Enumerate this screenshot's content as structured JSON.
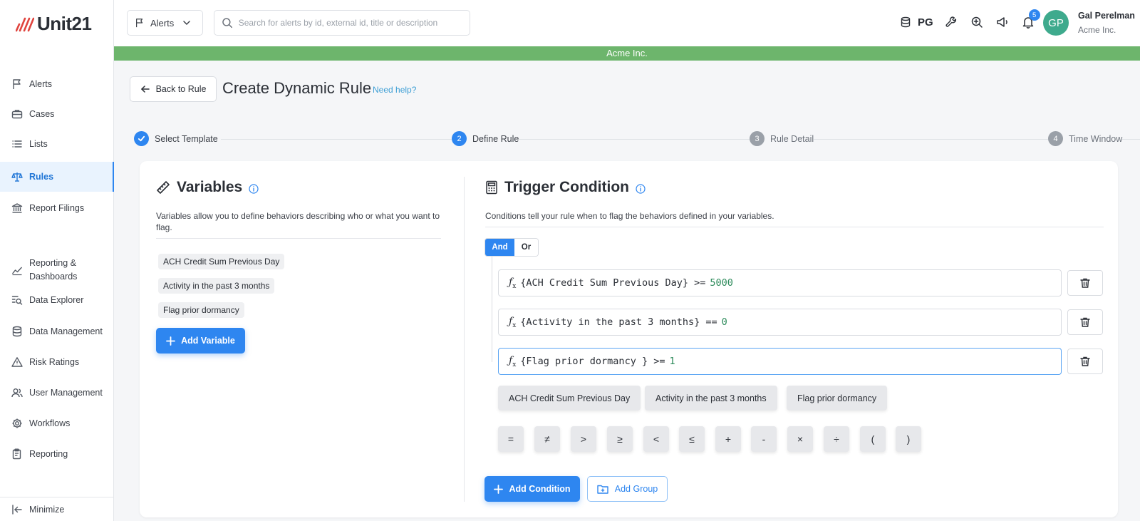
{
  "brand": {
    "logo_text": "Unit21"
  },
  "sidebar": {
    "items": [
      {
        "label": "Alerts"
      },
      {
        "label": "Cases"
      },
      {
        "label": "Lists"
      },
      {
        "label": "Rules"
      },
      {
        "label": "Report Filings"
      },
      {
        "label": "Reporting & Dashboards"
      },
      {
        "label": "Data Explorer"
      },
      {
        "label": "Data Management"
      },
      {
        "label": "Risk Ratings"
      },
      {
        "label": "User Management"
      },
      {
        "label": "Workflows"
      },
      {
        "label": "Reporting"
      }
    ],
    "active": "Rules",
    "minimize_label": "Minimize"
  },
  "header": {
    "dropdown_label": "Alerts",
    "search_placeholder": "Search for alerts by id, external id, title or description",
    "pg_label": "PG",
    "notification_count": "5",
    "avatar_initials": "GP",
    "user_name": "Gal Perelman",
    "user_org": "Acme Inc.",
    "org_banner": "Acme Inc."
  },
  "page": {
    "back_label": "Back to Rule",
    "title": "Create Dynamic Rule",
    "help_link": "Need help?"
  },
  "stepper": {
    "steps": [
      {
        "number": "1",
        "label": "Select Template",
        "state": "done"
      },
      {
        "number": "2",
        "label": "Define Rule",
        "state": "current"
      },
      {
        "number": "3",
        "label": "Rule Detail",
        "state": "todo"
      },
      {
        "number": "4",
        "label": "Time Window",
        "state": "todo"
      }
    ]
  },
  "variables": {
    "title": "Variables",
    "description": "Variables allow you to define behaviors describing who or what you want to flag.",
    "items": [
      "ACH Credit Sum Previous Day",
      "Activity in the past 3 months",
      "Flag prior dormancy"
    ],
    "add_label": "Add Variable"
  },
  "trigger": {
    "title": "Trigger Condition",
    "description": "Conditions tell your rule when to flag the behaviors defined in your variables.",
    "logic_and": "And",
    "logic_or": "Or",
    "logic_selected": "And",
    "fx_symbol": "ƒ",
    "fx_sub": "x",
    "conditions": [
      {
        "expr": "{ACH Credit Sum Previous Day} >=",
        "value": "5000"
      },
      {
        "expr": "{Activity in the past 3 months} ==",
        "value": "0"
      },
      {
        "expr": "{Flag prior dormancy } >=",
        "value": "1"
      }
    ],
    "variable_chips": [
      "ACH Credit Sum Previous Day",
      "Activity in the past 3 months",
      "Flag prior dormancy"
    ],
    "operators": [
      "=",
      "≠",
      ">",
      "≥",
      "<",
      "≤",
      "+",
      "-",
      "×",
      "÷",
      "(",
      ")"
    ],
    "add_condition_label": "Add Condition",
    "add_group_label": "Add Group"
  },
  "colors": {
    "primary": "#2e86f0",
    "banner": "#6db56c",
    "avatar": "#3eaa8d",
    "number_literal": "#2c8a5a"
  }
}
